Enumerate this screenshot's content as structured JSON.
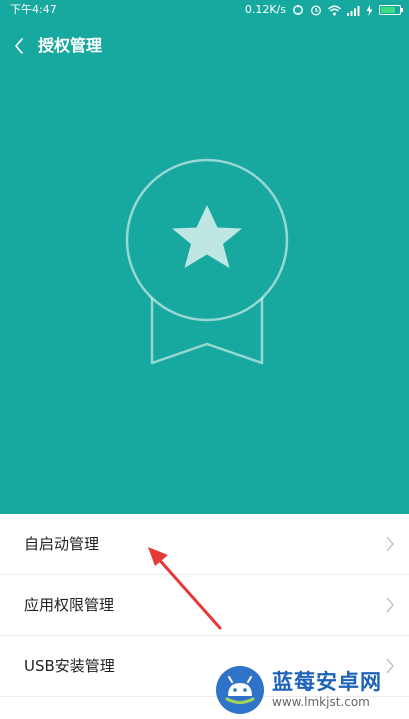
{
  "status_bar": {
    "time": "下午4:47",
    "net_speed": "0.12K/s"
  },
  "header": {
    "title": "授权管理"
  },
  "menu": {
    "items": [
      {
        "label": "自启动管理"
      },
      {
        "label": "应用权限管理"
      },
      {
        "label": "USB安装管理"
      }
    ]
  },
  "watermark": {
    "title": "蓝莓安卓网",
    "url": "www.lmkjst.com"
  },
  "colors": {
    "hero_bg": "#17a89f",
    "accent_arrow": "#e53935",
    "battery": "#3ddc84"
  },
  "battery_level": 0.8
}
